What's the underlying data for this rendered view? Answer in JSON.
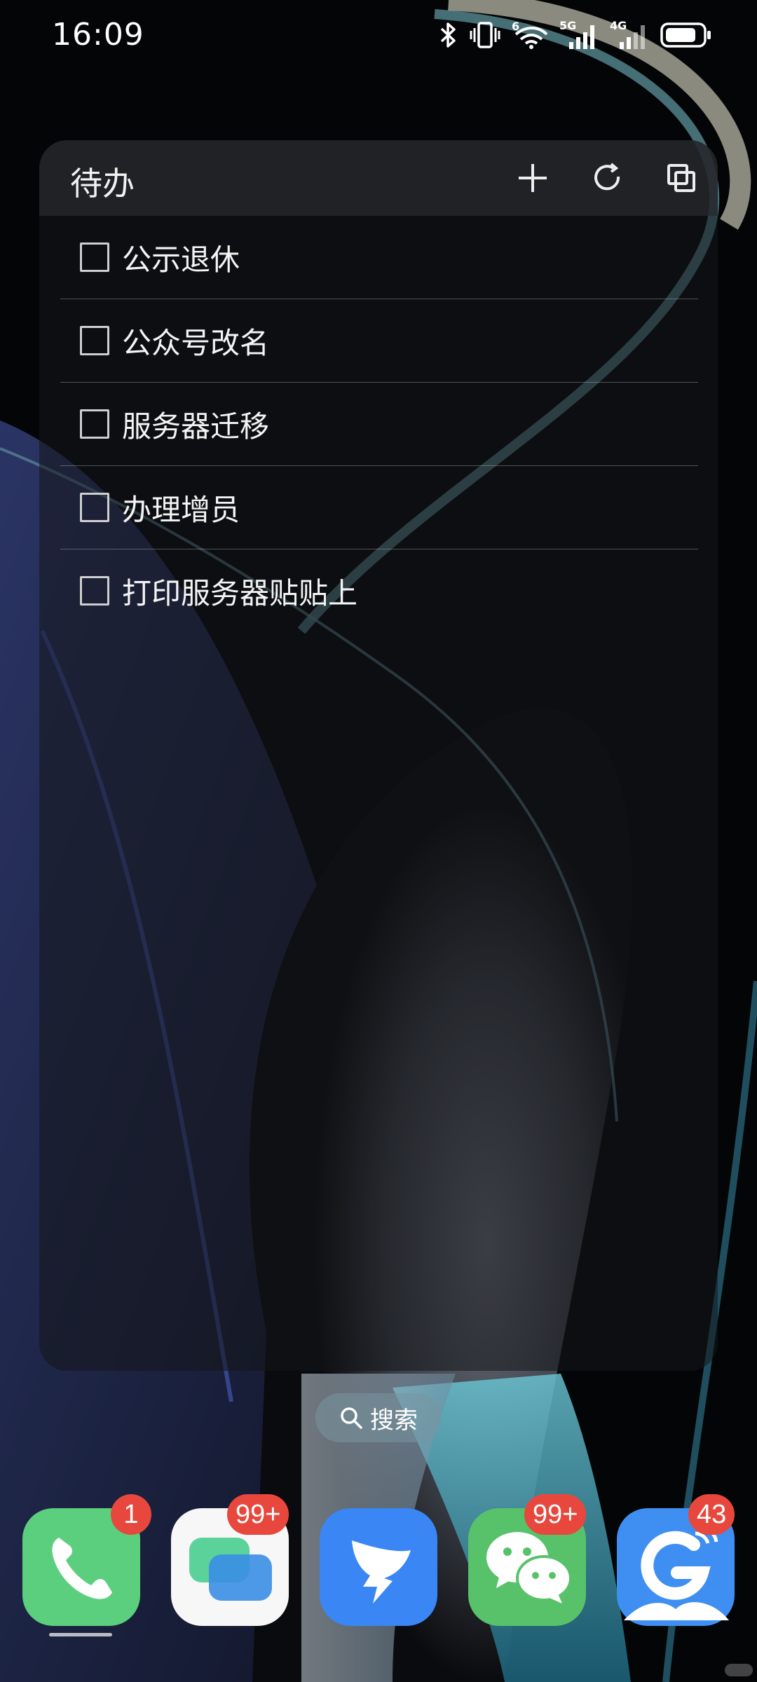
{
  "status_bar": {
    "time": "16:09",
    "network_1": "5G",
    "network_2": "4G",
    "wifi_index": "6"
  },
  "widget": {
    "title": "待办",
    "actions": [
      "plus-icon",
      "refresh-icon",
      "copy-icon"
    ],
    "items": [
      {
        "text": "公示退休",
        "checked": false
      },
      {
        "text": "公众号改名",
        "checked": false
      },
      {
        "text": "服务器迁移",
        "checked": false
      },
      {
        "text": "办理增员",
        "checked": false
      },
      {
        "text": "打印服务器贴贴上",
        "checked": false
      }
    ]
  },
  "search": {
    "label": "搜索"
  },
  "dock": [
    {
      "icon": "phone-icon",
      "badge": "1",
      "color": "#5ccf7e"
    },
    {
      "icon": "chat-bubbles-icon",
      "badge": "99+",
      "color": "#f7f7f7"
    },
    {
      "icon": "dingtalk-icon",
      "badge": "",
      "color": "#3a86f4"
    },
    {
      "icon": "wechat-icon",
      "badge": "99+",
      "color": "#57c26a"
    },
    {
      "icon": "g-app-icon",
      "badge": "43",
      "color": "#3f8ff2"
    }
  ]
}
